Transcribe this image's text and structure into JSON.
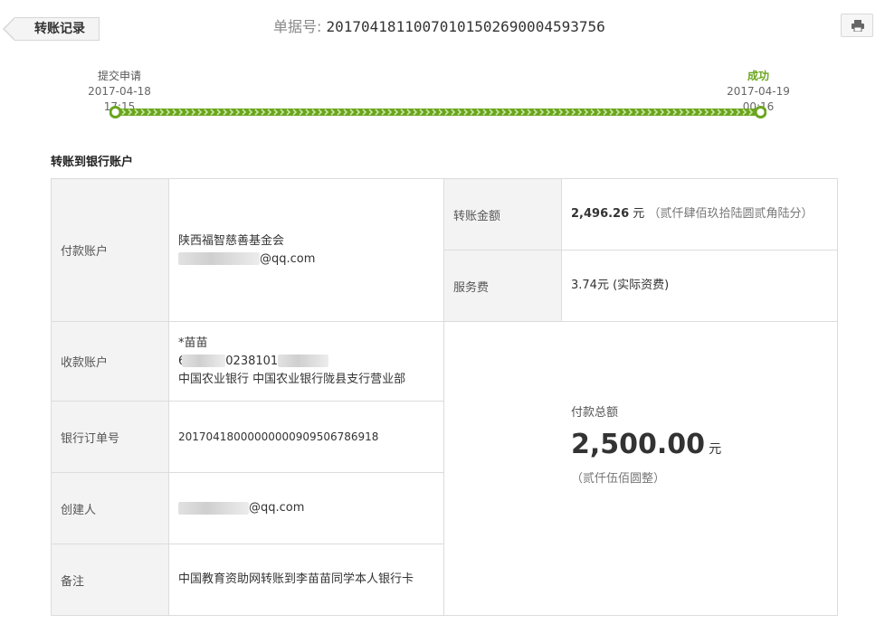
{
  "header": {
    "back_label": "转账记录",
    "order_label": "单据号:",
    "order_number": "20170418110070101502690004593756",
    "print_icon": "printer-icon"
  },
  "progress": {
    "start_title": "提交申请",
    "start_time": "2017-04-18 17:15",
    "end_title": "成功",
    "end_time": "2017-04-19 00:16",
    "color": "#6aa51e"
  },
  "section": {
    "title": "转账到银行账户"
  },
  "payer": {
    "label": "付款账户",
    "name": "陕西福智慈善基金会",
    "email_suffix": "@qq.com"
  },
  "transfer_amount": {
    "label": "转账金额",
    "value": "2,496.26",
    "unit": "元",
    "words": "（贰仟肆佰玖拾陆圆贰角陆分）"
  },
  "service_fee": {
    "label": "服务费",
    "value": "3.74元 (实际资费)"
  },
  "payee": {
    "label": "收款账户",
    "name": "*苗苗",
    "account_prefix": "6",
    "account_mid": "0238101",
    "bank": "中国农业银行 中国农业银行陇县支行营业部"
  },
  "bank_order": {
    "label": "银行订单号",
    "value": "20170418000000000909506786918"
  },
  "creator": {
    "label": "创建人",
    "email_suffix": "@qq.com"
  },
  "remark": {
    "label": "备注",
    "value": "中国教育资助网转账到李苗苗同学本人银行卡"
  },
  "total": {
    "label": "付款总额",
    "value": "2,500.00",
    "unit": "元",
    "words": "（贰仟伍佰圆整）"
  }
}
